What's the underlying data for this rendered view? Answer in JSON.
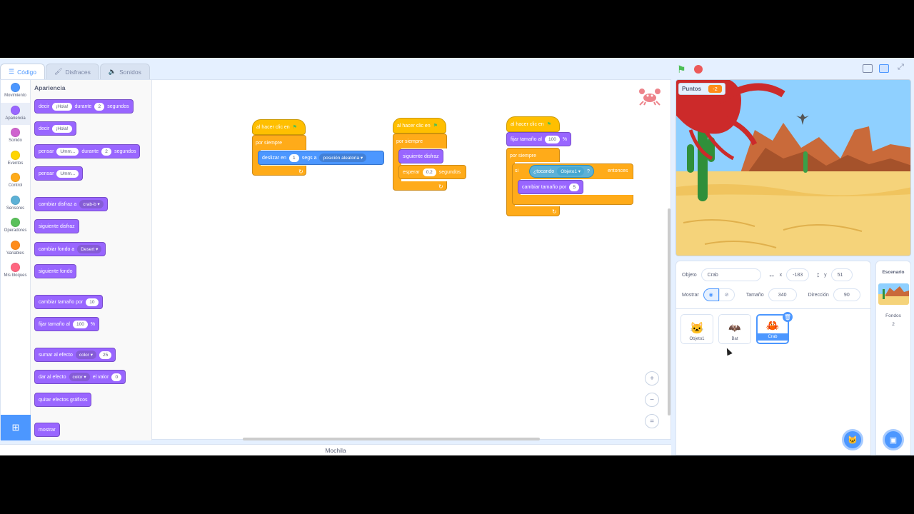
{
  "tabs": [
    {
      "label": "Código",
      "icon": "code-icon"
    },
    {
      "label": "Disfraces",
      "icon": "brush-icon"
    },
    {
      "label": "Sonidos",
      "icon": "speaker-icon"
    }
  ],
  "categories": [
    {
      "label": "Movimiento",
      "color": "#4c97ff"
    },
    {
      "label": "Apariencia",
      "color": "#9966ff"
    },
    {
      "label": "Sonido",
      "color": "#cf63cf"
    },
    {
      "label": "Eventos",
      "color": "#ffd500"
    },
    {
      "label": "Control",
      "color": "#ffab19"
    },
    {
      "label": "Sensores",
      "color": "#5cb1d6"
    },
    {
      "label": "Operadores",
      "color": "#59c059"
    },
    {
      "label": "Variables",
      "color": "#ff8c1a"
    },
    {
      "label": "Mis bloques",
      "color": "#ff6680"
    }
  ],
  "palette": {
    "title": "Apariencia",
    "b1": {
      "a": "decir",
      "b": "¡Hola!",
      "c": "durante",
      "d": "2",
      "e": "segundos"
    },
    "b2": {
      "a": "decir",
      "b": "¡Hola!"
    },
    "b3": {
      "a": "pensar",
      "b": "Umm...",
      "c": "durante",
      "d": "2",
      "e": "segundos"
    },
    "b4": {
      "a": "pensar",
      "b": "Umm..."
    },
    "b5": {
      "a": "cambiar disfraz a",
      "b": "crab-b"
    },
    "b6": {
      "a": "siguiente disfraz"
    },
    "b7": {
      "a": "cambiar fondo a",
      "b": "Desert"
    },
    "b8": {
      "a": "siguiente fondo"
    },
    "b9": {
      "a": "cambiar tamaño por",
      "b": "10"
    },
    "b10": {
      "a": "fijar tamaño al",
      "b": "100",
      "c": "%"
    },
    "b11": {
      "a": "sumar al efecto",
      "b": "color",
      "c": "25"
    },
    "b12": {
      "a": "dar al efecto",
      "b": "color",
      "c": "el valor",
      "d": "0"
    },
    "b13": {
      "a": "quitar efectos gráficos"
    },
    "b14": {
      "a": "mostrar"
    }
  },
  "scripts": {
    "s1": {
      "hat": "al hacer clic en",
      "loop": "por siempre",
      "glide": "deslizar en",
      "secs": "1",
      "segs": "segs a",
      "target": "posición aleatoria"
    },
    "s2": {
      "hat": "al hacer clic en",
      "loop": "por siempre",
      "next": "siguiente disfraz",
      "wait": "esperar",
      "secs": "0.2",
      "unit": "segundos"
    },
    "s3": {
      "hat": "al hacer clic en",
      "setsize": "fijar tamaño al",
      "size": "100",
      "pct": "%",
      "loop": "por siempre",
      "if": "si",
      "touching": "¿tocando",
      "obj": "Objeto1",
      "q": "?",
      "then": "entonces",
      "change": "cambiar tamaño por",
      "amount": "5"
    }
  },
  "zoom": {
    "in": "+",
    "out": "−",
    "reset": "="
  },
  "backpack": "Mochila",
  "stage": {
    "monitor_label": "Puntos",
    "monitor_value": "-2"
  },
  "sprite_info": {
    "object_label": "Objeto",
    "name": "Crab",
    "x_label": "x",
    "x": "-183",
    "y_label": "y",
    "y": "51",
    "show_label": "Mostrar",
    "size_label": "Tamaño",
    "size": "340",
    "direction_label": "Dirección",
    "direction": "90"
  },
  "sprites": [
    {
      "name": "Objeto1"
    },
    {
      "name": "Bat"
    },
    {
      "name": "Crab"
    }
  ],
  "stage_pane": {
    "title": "Escenario",
    "backdrops_label": "Fondos",
    "backdrops_count": "2"
  },
  "colors": {
    "accent": "#4c97ff",
    "looks": "#9966ff",
    "control": "#ffab19",
    "events": "#ffbf00",
    "sensing": "#5cb1d6",
    "variable": "#ff8c1a"
  }
}
